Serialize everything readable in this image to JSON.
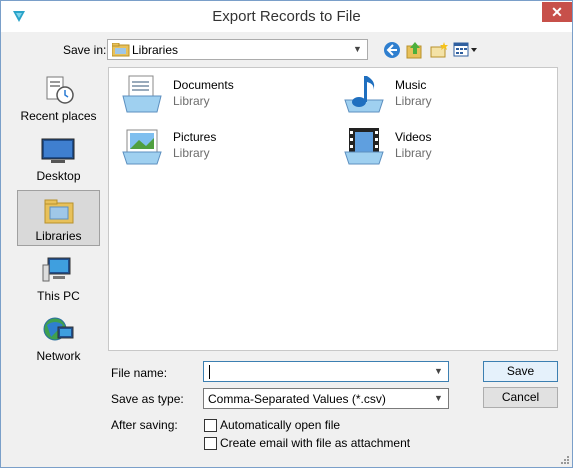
{
  "window": {
    "title": "Export Records to File",
    "close_glyph": "✕",
    "app_icon": "app-logo-icon"
  },
  "toolbar": {
    "save_in_label": "Save in:",
    "location": "Libraries",
    "buttons": [
      "back-icon",
      "up-folder-icon",
      "new-folder-icon",
      "view-menu-icon"
    ]
  },
  "places": [
    {
      "label": "Recent places",
      "icon": "recent-places-icon"
    },
    {
      "label": "Desktop",
      "icon": "desktop-icon"
    },
    {
      "label": "Libraries",
      "icon": "libraries-icon",
      "selected": true
    },
    {
      "label": "This PC",
      "icon": "this-pc-icon"
    },
    {
      "label": "Network",
      "icon": "network-icon"
    }
  ],
  "items": [
    {
      "name": "Documents",
      "type": "Library",
      "icon": "documents-library-icon"
    },
    {
      "name": "Music",
      "type": "Library",
      "icon": "music-library-icon"
    },
    {
      "name": "Pictures",
      "type": "Library",
      "icon": "pictures-library-icon"
    },
    {
      "name": "Videos",
      "type": "Library",
      "icon": "videos-library-icon"
    }
  ],
  "form": {
    "file_name_label": "File name:",
    "file_name_value": "",
    "save_as_type_label": "Save as type:",
    "save_as_type_value": "Comma-Separated Values (*.csv)",
    "after_saving_label": "After saving:",
    "auto_open_label": "Automatically open file",
    "auto_open_checked": false,
    "email_label": "Create email with file as attachment",
    "email_checked": false
  },
  "buttons": {
    "save": "Save",
    "cancel": "Cancel"
  },
  "colors": {
    "accent": "#3c7fb1",
    "close": "#c7504a",
    "secondary_text": "#6d6d6d"
  }
}
